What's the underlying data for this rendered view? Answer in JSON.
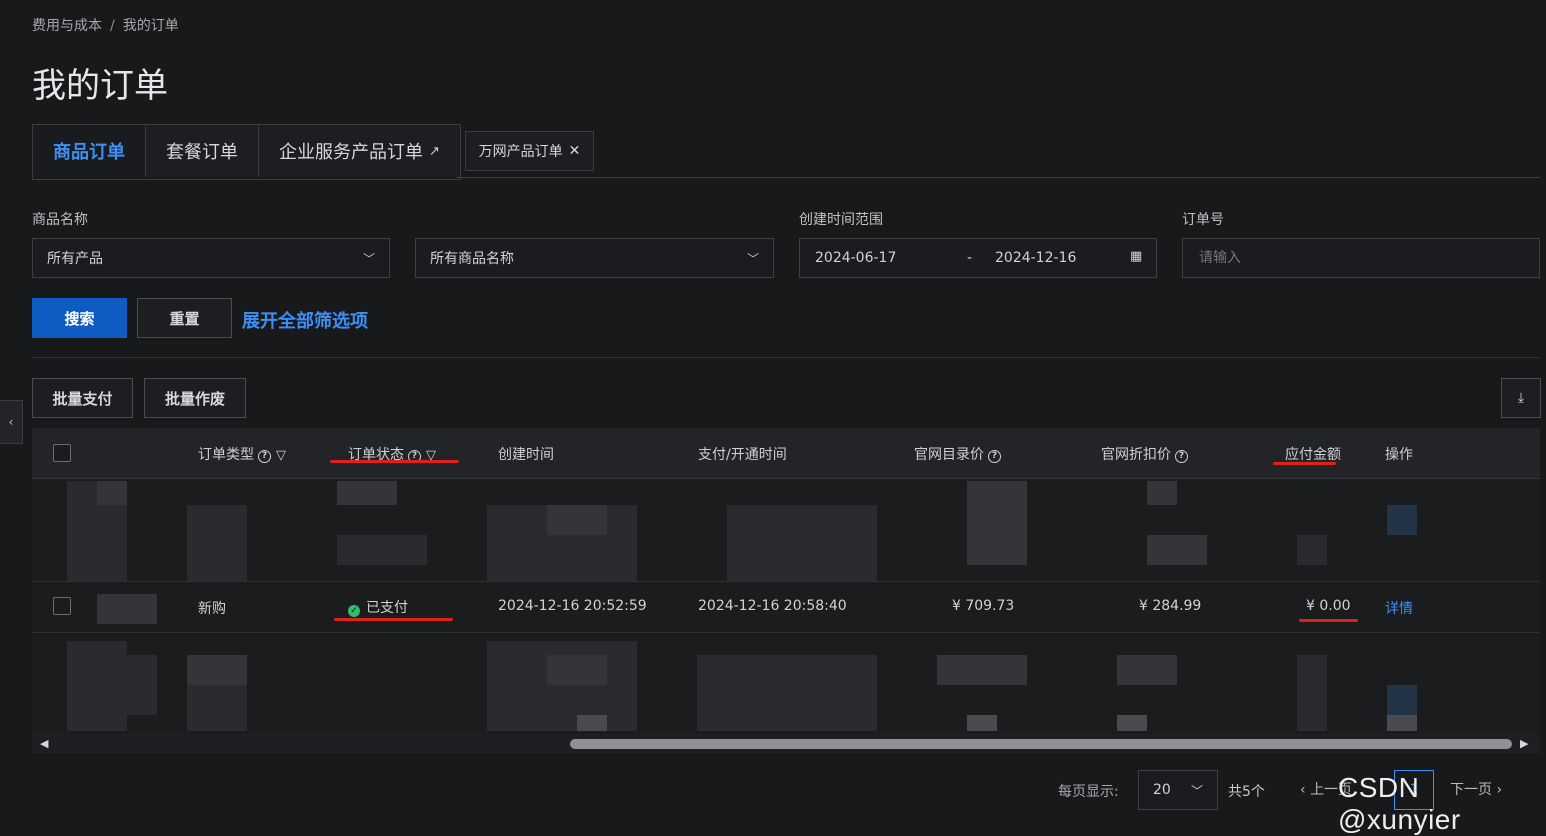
{
  "breadcrumb": {
    "parent": "费用与成本",
    "separator": "/",
    "current": "我的订单"
  },
  "page_title": "我的订单",
  "tabs": [
    {
      "label": "商品订单"
    },
    {
      "label": "套餐订单"
    },
    {
      "label": "企业服务产品订单"
    }
  ],
  "tab_tag": {
    "label": "万网产品订单"
  },
  "filters": {
    "product_name_label": "商品名称",
    "product_select_value": "所有产品",
    "product_name_select_value": "所有商品名称",
    "date_range_label": "创建时间范围",
    "date_start": "2024-06-17",
    "date_sep": "-",
    "date_end": "2024-12-16",
    "order_no_label": "订单号",
    "order_no_placeholder": "请输入"
  },
  "actions": {
    "search": "搜索",
    "reset": "重置",
    "expand": "展开全部筛选项"
  },
  "batch": {
    "pay": "批量支付",
    "void": "批量作废"
  },
  "table": {
    "headers": {
      "order_type": "订单类型",
      "order_status": "订单状态",
      "created_time": "创建时间",
      "paid_time": "支付/开通时间",
      "list_price": "官网目录价",
      "discount_price": "官网折扣价",
      "payable": "应付金额",
      "action": "操作"
    },
    "row": {
      "order_type": "新购",
      "status": "已支付",
      "created_time": "2024-12-16 20:52:59",
      "paid_time": "2024-12-16 20:58:40",
      "list_price": "¥ 709.73",
      "discount_price": "¥ 284.99",
      "payable": "¥ 0.00",
      "action": "详情"
    }
  },
  "pagination": {
    "per_page_label": "每页显示:",
    "per_page_value": "20",
    "total": "共5个",
    "prev": "上一页",
    "next": "下一页",
    "current_page": "1"
  },
  "watermark": "CSDN @xunyier",
  "colors": {
    "accent": "#3d8ff6",
    "primary_button": "#0e5cc2",
    "success": "#2fbf6a",
    "annotation": "#e0201a"
  }
}
